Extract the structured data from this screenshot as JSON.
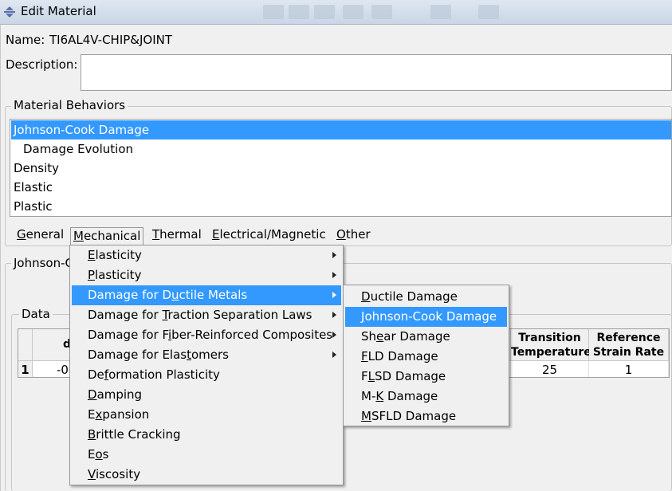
{
  "window": {
    "title": "Edit Material"
  },
  "form": {
    "name_label": "Name:",
    "name_value": "TI6AL4V-CHIP&JOINT",
    "description_label": "Description:",
    "description_value": ""
  },
  "behaviors": {
    "legend": "Material Behaviors",
    "items": [
      {
        "label": "Johnson-Cook Damage",
        "selected": true
      },
      {
        "label": "Damage Evolution",
        "indent": true
      },
      {
        "label": "Density"
      },
      {
        "label": "Elastic"
      },
      {
        "label": "Plastic"
      }
    ]
  },
  "menubar": [
    {
      "label": "General",
      "mnemonic": "G",
      "rest": "eneral"
    },
    {
      "label": "Mechanical",
      "mnemonic": "M",
      "rest": "echanical",
      "open": true
    },
    {
      "label": "Thermal",
      "mnemonic": "T",
      "rest": "hermal"
    },
    {
      "label": "Electrical/Magnetic",
      "mnemonic": "E",
      "rest": "lectrical/Magnetic"
    },
    {
      "label": "Other",
      "mnemonic": "O",
      "rest": "ther"
    }
  ],
  "section": {
    "partial_title": "Johnson-C",
    "data_legend": "Data"
  },
  "table": {
    "partial_col1": "d",
    "col_transition": [
      "Transition",
      "Temperature"
    ],
    "col_reference": [
      "Reference",
      "Strain Rate"
    ],
    "row_index": "1",
    "row_partial_value": "-0",
    "row_transition": "25",
    "row_reference": "1"
  },
  "mechanical_menu": [
    {
      "pre": "",
      "u": "E",
      "post": "lasticity",
      "submenu": true
    },
    {
      "pre": "",
      "u": "P",
      "post": "lasticity",
      "submenu": true
    },
    {
      "pre": "Damage for D",
      "u": "u",
      "post": "ctile Metals",
      "submenu": true,
      "highlighted": true
    },
    {
      "pre": "Damage for ",
      "u": "T",
      "post": "raction Separation Laws",
      "submenu": true
    },
    {
      "pre": "Damage for F",
      "u": "i",
      "post": "ber-Reinforced Composites",
      "submenu": true
    },
    {
      "pre": "Damage for Elas",
      "u": "t",
      "post": "omers",
      "submenu": true
    },
    {
      "pre": "De",
      "u": "f",
      "post": "ormation Plasticity"
    },
    {
      "pre": "",
      "u": "D",
      "post": "amping"
    },
    {
      "pre": "E",
      "u": "x",
      "post": "pansion"
    },
    {
      "pre": "",
      "u": "B",
      "post": "rittle Cracking"
    },
    {
      "pre": "E",
      "u": "o",
      "post": "s"
    },
    {
      "pre": "",
      "u": "V",
      "post": "iscosity"
    }
  ],
  "ductile_submenu": [
    {
      "pre": "",
      "u": "D",
      "post": "uctile Damage"
    },
    {
      "pre": "",
      "u": "J",
      "post": "ohnson-Cook Damage",
      "highlighted": true
    },
    {
      "pre": "Sh",
      "u": "e",
      "post": "ar Damage"
    },
    {
      "pre": "",
      "u": "F",
      "post": "LD Damage"
    },
    {
      "pre": "F",
      "u": "L",
      "post": "SD Damage"
    },
    {
      "pre": "M-",
      "u": "K",
      "post": " Damage"
    },
    {
      "pre": "",
      "u": "M",
      "post": "SFLD Damage"
    }
  ],
  "colors": {
    "selection": "#3399ff",
    "menu_bg": "#f0f0f0"
  }
}
